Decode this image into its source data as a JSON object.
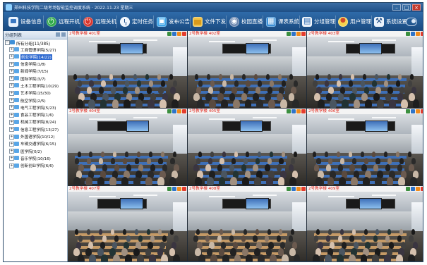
{
  "window": {
    "title": "郑州科技学院二级考场智能监控调度系统 · 2022-11-23 星期三"
  },
  "toolbar": {
    "items": [
      {
        "label": "设备信息",
        "icon": "device-icon"
      },
      {
        "label": "远程开机",
        "icon": "power-on-icon"
      },
      {
        "label": "远程关机",
        "icon": "power-off-icon"
      },
      {
        "label": "定时任务",
        "icon": "timer-icon"
      },
      {
        "label": "发布公告",
        "icon": "notice-icon"
      },
      {
        "label": "文件下发",
        "icon": "file-icon"
      },
      {
        "label": "校园直播",
        "icon": "live-icon"
      },
      {
        "label": "课表系统",
        "icon": "course-icon"
      },
      {
        "label": "分组管理",
        "icon": "group-icon"
      },
      {
        "label": "用户管理",
        "icon": "users-icon"
      },
      {
        "label": "系统设置",
        "icon": "settings-icon"
      }
    ]
  },
  "sidebar": {
    "header": "分组列表",
    "root": "所有分组(11/385)",
    "groups": [
      "工商管理学院(5/27)",
      "创业学院(14/22)",
      "信息学院(1/8)",
      "新闻学院(7/15)",
      "国际学院(3/7)",
      "土木工程学院(10/29)",
      "艺术学院(15/30)",
      "航空学院(2/5)",
      "电气工程学院(5/23)",
      "食品工程学院(1/6)",
      "机械工程学院(8/24)",
      "信息工程学院(13/27)",
      "外国语学院(10/12)",
      "车辆交通学院(6/15)",
      "医学院(0/2)",
      "音乐学院(10/16)",
      "创新创业学院(6/6)"
    ],
    "selected_index": 1
  },
  "cameras": [
    {
      "name": "2号教学楼 401室"
    },
    {
      "name": "2号教学楼 402室"
    },
    {
      "name": "2号教学楼 403室"
    },
    {
      "name": "2号教学楼 404室"
    },
    {
      "name": "2号教学楼 405室"
    },
    {
      "name": "2号教学楼 406室"
    },
    {
      "name": "2号教学楼 407室"
    },
    {
      "name": "2号教学楼 408室"
    },
    {
      "name": "2号教学楼 409室"
    }
  ],
  "active_camera": 8,
  "colors": {
    "toolbar": "#23588f",
    "camera_label": "#e1271b",
    "selection": "#2f6ad0",
    "active_border": "#ffe83a"
  }
}
